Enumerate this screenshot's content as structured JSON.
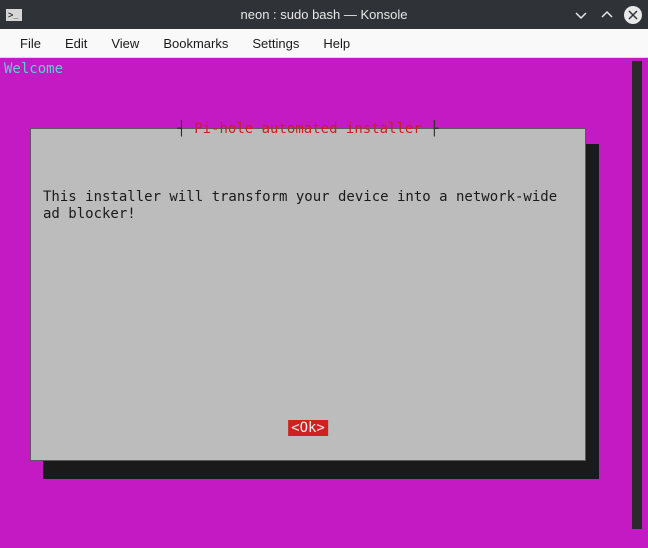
{
  "window": {
    "title": "neon : sudo bash — Konsole",
    "icon_glyph": ">_"
  },
  "menu": {
    "items": [
      "File",
      "Edit",
      "View",
      "Bookmarks",
      "Settings",
      "Help"
    ]
  },
  "terminal": {
    "welcome": "Welcome",
    "dialog": {
      "title_left_bracket": "┤ ",
      "title": "Pi-hole automated installer",
      "title_right_bracket": " ├",
      "body": "This installer will transform your device into a network-wide ad blocker!",
      "ok_label": "<Ok>"
    }
  },
  "colors": {
    "magenta": "#c41ac4",
    "dialog_bg": "#bcbcbc",
    "title_red": "#c92020",
    "ok_bg": "#d02020"
  }
}
